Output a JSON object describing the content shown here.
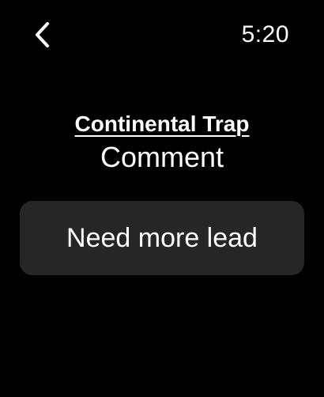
{
  "status_bar": {
    "back_icon": "chevron-left-icon",
    "time": "5:20"
  },
  "header": {
    "title": "Continental Trap",
    "subtitle": "Comment"
  },
  "comment": {
    "text": "Need more lead"
  },
  "colors": {
    "background": "#000000",
    "card": "#262626",
    "text": "#ffffff"
  }
}
